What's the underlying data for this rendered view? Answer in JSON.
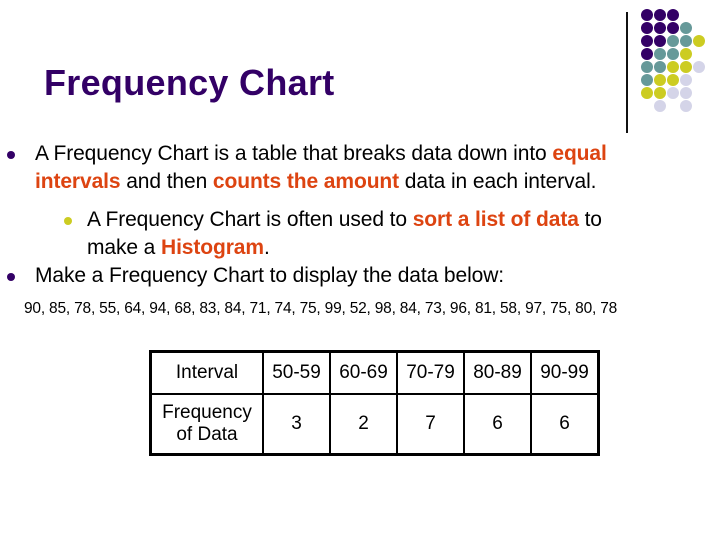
{
  "slide": {
    "title": "Frequency Chart",
    "decoration": {
      "dot_colors": {
        "P": "#330066",
        "T": "#669999",
        "Y": "#CCCC22",
        "L": "#D4D4E8"
      },
      "dot_grid": [
        "PPP..",
        "PPPT.",
        "PPTTY",
        "PTTY.",
        "TTYYL",
        "TYYL.",
        "YYLL.",
        ".L.L."
      ]
    },
    "bullets": [
      {
        "level": 1,
        "lines": [
          [
            {
              "text": "A Frequency Chart is a table that breaks data down into ",
              "highlight": false
            },
            {
              "text": "equal",
              "highlight": true
            }
          ],
          [
            {
              "text": "intervals",
              "highlight": true
            },
            {
              "text": " and then ",
              "highlight": false
            },
            {
              "text": "counts the amount",
              "highlight": true
            },
            {
              "text": " data in each interval.",
              "highlight": false
            }
          ]
        ]
      },
      {
        "level": 2,
        "lines": [
          [
            {
              "text": "A Frequency Chart is often used to ",
              "highlight": false
            },
            {
              "text": "sort a list of data",
              "highlight": true
            },
            {
              "text": " to",
              "highlight": false
            }
          ],
          [
            {
              "text": "make a ",
              "highlight": false
            },
            {
              "text": "Histogram",
              "highlight": true
            },
            {
              "text": ".",
              "highlight": false
            }
          ]
        ]
      },
      {
        "level": 1,
        "lines": [
          [
            {
              "text": "Make a Frequency Chart to display the data below:",
              "highlight": false
            }
          ]
        ]
      }
    ],
    "data_list": "90, 85, 78, 55, 64, 94, 68, 83, 84, 71, 74, 75, 99, 52, 98, 84, 73, 96, 81, 58, 97, 75, 80, 78",
    "colors": {
      "title": "#330066",
      "highlight": "#DD4411",
      "bullet_level1": "#330066",
      "bullet_level2": "#CCCC22"
    }
  },
  "table": {
    "row_headers": [
      "Interval",
      "Frequency of Data"
    ],
    "row_header_lines": [
      [
        "Interval"
      ],
      [
        "Frequency",
        "of Data"
      ]
    ],
    "intervals": [
      "50-59",
      "60-69",
      "70-79",
      "80-89",
      "90-99"
    ],
    "frequencies": [
      "3",
      "2",
      "7",
      "6",
      "6"
    ]
  }
}
